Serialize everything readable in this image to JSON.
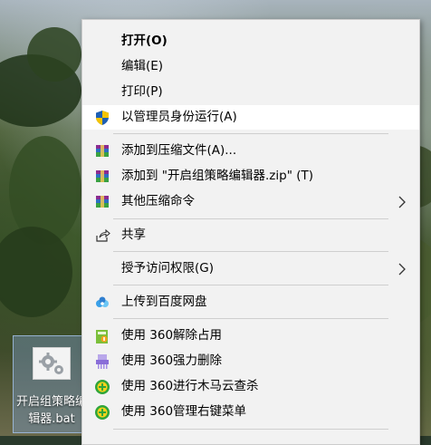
{
  "desktop": {
    "file_name": "开启组策略编\n辑器.bat"
  },
  "menu": {
    "items": [
      {
        "id": "open",
        "label": "打开(O)",
        "icon": "",
        "submenu": false
      },
      {
        "id": "edit",
        "label": "编辑(E)",
        "icon": "",
        "submenu": false
      },
      {
        "id": "print",
        "label": "打印(P)",
        "icon": "",
        "submenu": false
      },
      {
        "id": "run-as-admin",
        "label": "以管理员身份运行(A)",
        "icon": "uac-shield-icon",
        "submenu": false
      },
      {
        "id": "add-to-archive",
        "label": "添加到压缩文件(A)...",
        "icon": "winrar-archive-icon",
        "submenu": false
      },
      {
        "id": "add-to-zip",
        "label": "添加到 \"开启组策略编辑器.zip\" (T)",
        "icon": "winrar-archive-icon",
        "submenu": false
      },
      {
        "id": "other-compress",
        "label": "其他压缩命令",
        "icon": "winrar-archive-icon",
        "submenu": true
      },
      {
        "id": "share",
        "label": "共享",
        "icon": "share-icon",
        "submenu": false
      },
      {
        "id": "grant-access",
        "label": "授予访问权限(G)",
        "icon": "",
        "submenu": true
      },
      {
        "id": "baidu-upload",
        "label": "上传到百度网盘",
        "icon": "baidu-netdisk-icon",
        "submenu": false
      },
      {
        "id": "360-unlock",
        "label": "使用 360解除占用",
        "icon": "360-unlock-icon",
        "submenu": false
      },
      {
        "id": "360-shred",
        "label": "使用 360强力删除",
        "icon": "360-shred-icon",
        "submenu": false
      },
      {
        "id": "360-scan",
        "label": "使用 360进行木马云查杀",
        "icon": "360-scan-icon",
        "submenu": false
      },
      {
        "id": "360-menu",
        "label": "使用 360管理右键菜单",
        "icon": "360-manage-icon",
        "submenu": false
      }
    ]
  },
  "colors": {
    "menu_bg": "#f2f2f2",
    "hover_bg": "#ffffff",
    "separator": "#cfcfcf",
    "selection_bg": "#7896be"
  }
}
